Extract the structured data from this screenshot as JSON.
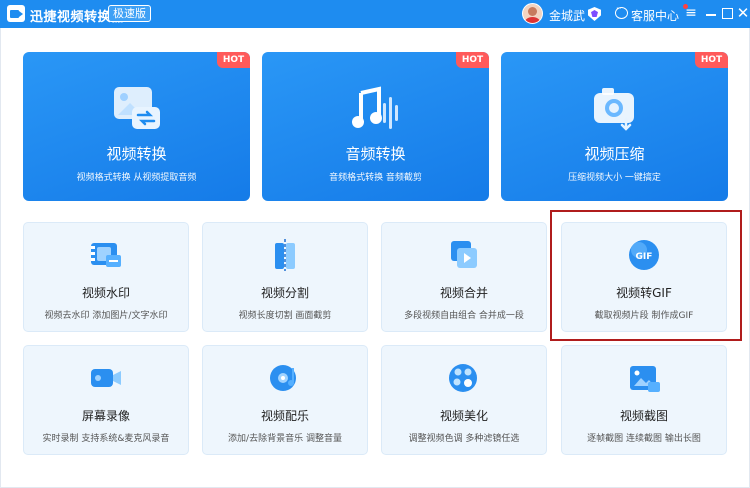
{
  "titlebar": {
    "app_title": "迅捷视频转换器",
    "edition": "极速版",
    "username": "金城武",
    "service": "客服中心",
    "menu_glyph": "≡",
    "close_glyph": "✕"
  },
  "big_cards": [
    {
      "title": "视频转换",
      "subtitle": "视频格式转换 从视频提取音频",
      "badge": "HOT",
      "icon": "video-convert-icon"
    },
    {
      "title": "音频转换",
      "subtitle": "音频格式转换 音频截剪",
      "badge": "HOT",
      "icon": "audio-convert-icon"
    },
    {
      "title": "视频压缩",
      "subtitle": "压缩视频大小 一键搞定",
      "badge": "HOT",
      "icon": "video-compress-icon"
    }
  ],
  "cards": [
    {
      "title": "视频水印",
      "subtitle": "视频去水印 添加图片/文字水印",
      "icon": "video-watermark-icon"
    },
    {
      "title": "视频分割",
      "subtitle": "视频长度切割 画面截剪",
      "icon": "video-split-icon"
    },
    {
      "title": "视频合并",
      "subtitle": "多段视频自由组合 合并成一段",
      "icon": "video-merge-icon"
    },
    {
      "title": "视频转GIF",
      "subtitle": "截取视频片段 制作成GIF",
      "icon": "gif-icon"
    },
    {
      "title": "屏幕录像",
      "subtitle": "实时录制 支持系统&麦克风录音",
      "icon": "screen-record-icon"
    },
    {
      "title": "视频配乐",
      "subtitle": "添加/去除背景音乐 调整音量",
      "icon": "video-music-icon"
    },
    {
      "title": "视频美化",
      "subtitle": "调整视频色调 多种滤镜任选",
      "icon": "video-beautify-icon"
    },
    {
      "title": "视频截图",
      "subtitle": "逐帧截图 连续截图 输出长图",
      "icon": "video-screenshot-icon"
    }
  ],
  "colors": {
    "accent": "#1e8cf0",
    "hot": "#ff5a5a",
    "highlight": "#b01c1c",
    "card_bg": "#eef6fd"
  }
}
